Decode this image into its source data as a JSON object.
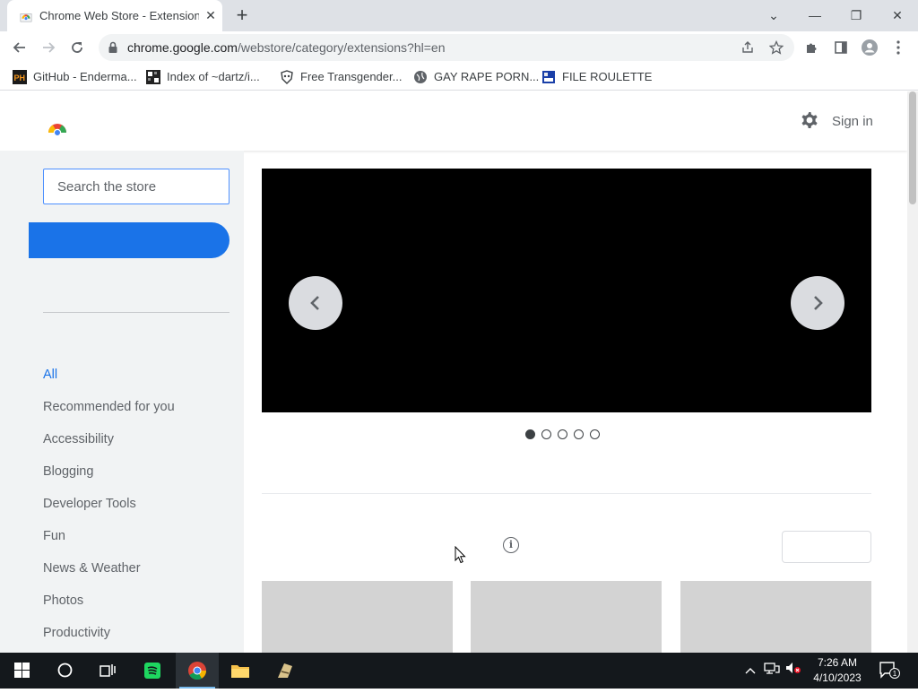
{
  "browser": {
    "tab_title": "Chrome Web Store - Extensions",
    "tab_close": "✕",
    "new_tab": "+",
    "url_host": "chrome.google.com",
    "url_path": "/webstore/category/extensions?hl=en",
    "window_controls": {
      "dropdown": "⌄",
      "minimize": "—",
      "restore": "❐",
      "close": "✕"
    },
    "bookmarks": [
      {
        "label": "GitHub - Enderma...",
        "icon": "ph-icon"
      },
      {
        "label": "Index of ~dartz/i...",
        "icon": "grid-icon"
      },
      {
        "label": "Free Transgender...",
        "icon": "mask-icon"
      },
      {
        "label": "GAY RAPE PORN...",
        "icon": "globe-icon"
      },
      {
        "label": "FILE ROULETTE",
        "icon": "file-icon"
      }
    ]
  },
  "store": {
    "signin_label": "Sign in",
    "search_placeholder": "Search the store",
    "categories": [
      "All",
      "Recommended for you",
      "Accessibility",
      "Blogging",
      "Developer Tools",
      "Fun",
      "News & Weather",
      "Photos",
      "Productivity"
    ],
    "active_category": "All",
    "carousel": {
      "slide_count": 5,
      "active_slide": 1,
      "prev_glyph": "‹",
      "next_glyph": "›"
    },
    "info_glyph": "i"
  },
  "taskbar": {
    "time": "7:26 AM",
    "date": "4/10/2023",
    "notification_count": "1"
  },
  "colors": {
    "accent": "#1a73e8",
    "sidebar_bg": "#f1f3f4",
    "carousel_bg": "#000000",
    "taskbar_bg": "#14181c"
  }
}
